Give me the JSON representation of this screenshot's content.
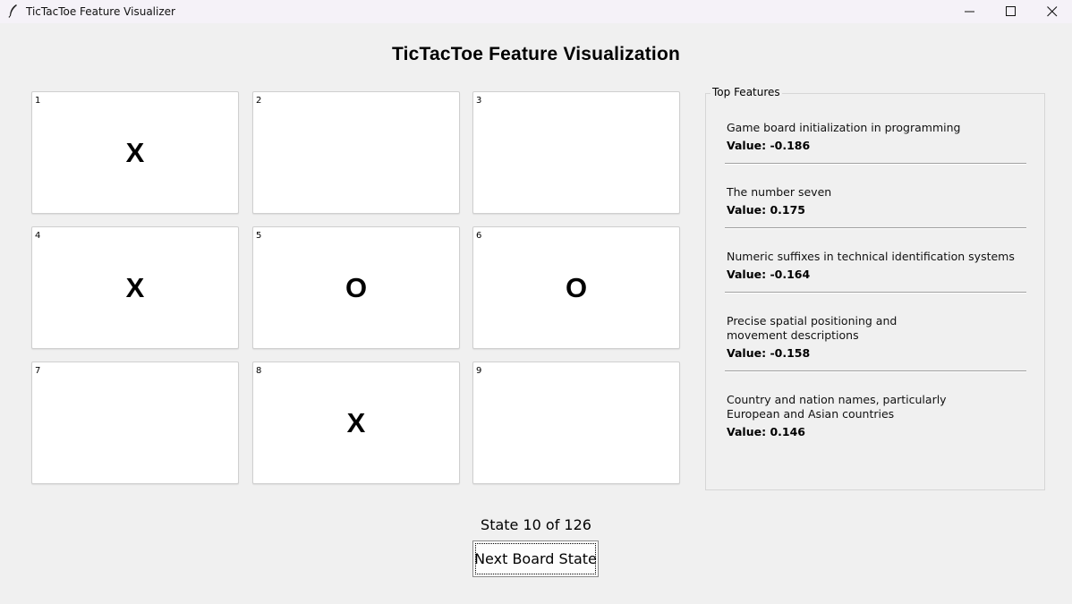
{
  "window": {
    "title": "TicTacToe Feature Visualizer",
    "icons": [
      "feather-icon",
      "minimize-icon",
      "maximize-icon",
      "close-icon"
    ]
  },
  "main": {
    "title": "TicTacToe Feature Visualization"
  },
  "board": {
    "cells": [
      {
        "num": "1",
        "mark": "X"
      },
      {
        "num": "2",
        "mark": ""
      },
      {
        "num": "3",
        "mark": ""
      },
      {
        "num": "4",
        "mark": "X"
      },
      {
        "num": "5",
        "mark": "O"
      },
      {
        "num": "6",
        "mark": "O"
      },
      {
        "num": "7",
        "mark": ""
      },
      {
        "num": "8",
        "mark": "X"
      },
      {
        "num": "9",
        "mark": ""
      }
    ]
  },
  "features": {
    "label": "Top Features",
    "items": [
      {
        "desc": "Game board initialization in programming",
        "value": "Value: -0.186"
      },
      {
        "desc": "The number seven",
        "value": "Value: 0.175"
      },
      {
        "desc": "Numeric suffixes in technical identification systems",
        "value": "Value: -0.164"
      },
      {
        "desc": "Precise spatial positioning and movement descriptions",
        "value": "Value: -0.158"
      },
      {
        "desc": "Country and nation names, particularly European and Asian countries",
        "value": "Value: 0.146"
      }
    ]
  },
  "footer": {
    "state": "State 10 of 126",
    "next_label": "Next Board State"
  }
}
